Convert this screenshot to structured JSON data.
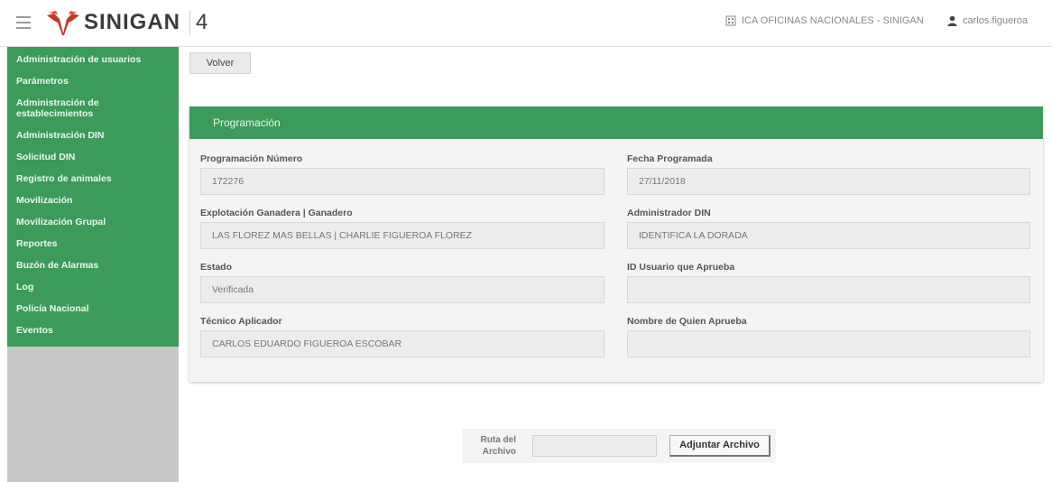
{
  "header": {
    "brand": "SINIGAN",
    "version": "4",
    "organization": "ICA OFICINAS NACIONALES - SINIGAN",
    "user": "carlos.figueroa"
  },
  "colors": {
    "accent": "#3c9a5a",
    "sidebar_bg": "#c8c8c8"
  },
  "sidebar": {
    "items": [
      "Administración de usuarios",
      "Parámetros",
      "Administración de establecimientos",
      "Administración DIN",
      "Solicitud DIN",
      "Registro de animales",
      "Movilización",
      "Movilización Grupal",
      "Reportes",
      "Buzón de Alarmas",
      "Log",
      "Policía Nacional",
      "Eventos"
    ]
  },
  "toolbar": {
    "back_label": "Volver"
  },
  "panel": {
    "title": "Programación",
    "fields": {
      "numero": {
        "label": "Programación Número",
        "value": "172276"
      },
      "fecha": {
        "label": "Fecha Programada",
        "value": "27/11/2018"
      },
      "explotacion": {
        "label": "Explotación Ganadera | Ganadero",
        "value": "LAS FLOREZ MAS BELLAS | CHARLIE FIGUEROA FLOREZ"
      },
      "admin_din": {
        "label": "Administrador DIN",
        "value": "IDENTIFICA LA DORADA"
      },
      "estado": {
        "label": "Estado",
        "value": "Verificada"
      },
      "usuario_aprueba": {
        "label": "ID Usuario que Aprueba",
        "value": ""
      },
      "tecnico": {
        "label": "Técnico Aplicador",
        "value": "CARLOS EDUARDO FIGUEROA ESCOBAR"
      },
      "nombre_aprueba": {
        "label": "Nombre de Quien Aprueba",
        "value": ""
      }
    }
  },
  "upload": {
    "label_line1": "Ruta del",
    "label_line2": "Archivo",
    "button_label": "Adjuntar Archivo"
  },
  "icons": {
    "menu": "hamburger-icon",
    "logo": "sinigan-logo",
    "organization": "building-icon",
    "user": "user-icon"
  }
}
